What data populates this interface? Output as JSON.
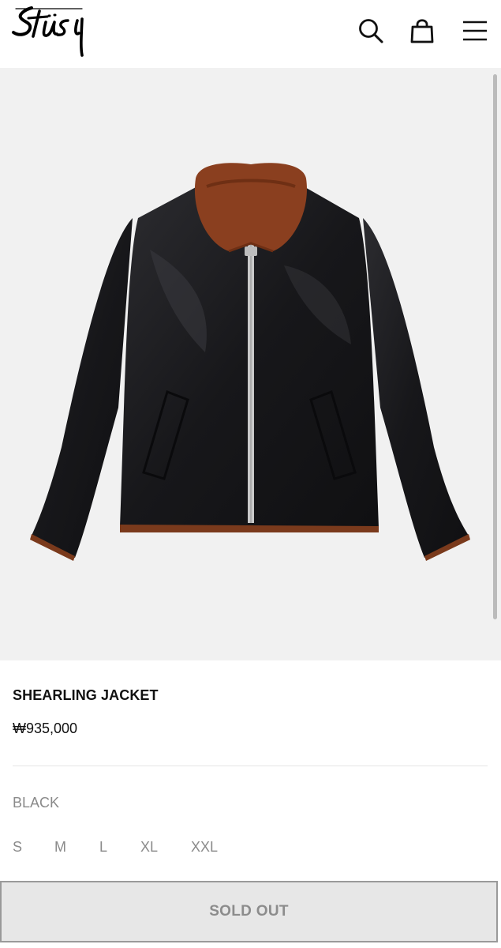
{
  "header": {
    "brand": "Stüssy",
    "icons": [
      "search-icon",
      "shopping-bag-icon",
      "hamburger-menu-icon"
    ]
  },
  "product": {
    "name": "SHEARLING JACKET",
    "price": "₩935,000",
    "color": "BLACK",
    "sizes": [
      "S",
      "M",
      "L",
      "XL",
      "XXL"
    ],
    "status_button": "SOLD OUT"
  },
  "colors": {
    "image_background": "#f1f1f1",
    "jacket_leather": "#1c1c1e",
    "shearling_collar": "#8a3f1f",
    "button_disabled_bg": "#e7e7e7",
    "muted_text": "#8a8a8a"
  }
}
